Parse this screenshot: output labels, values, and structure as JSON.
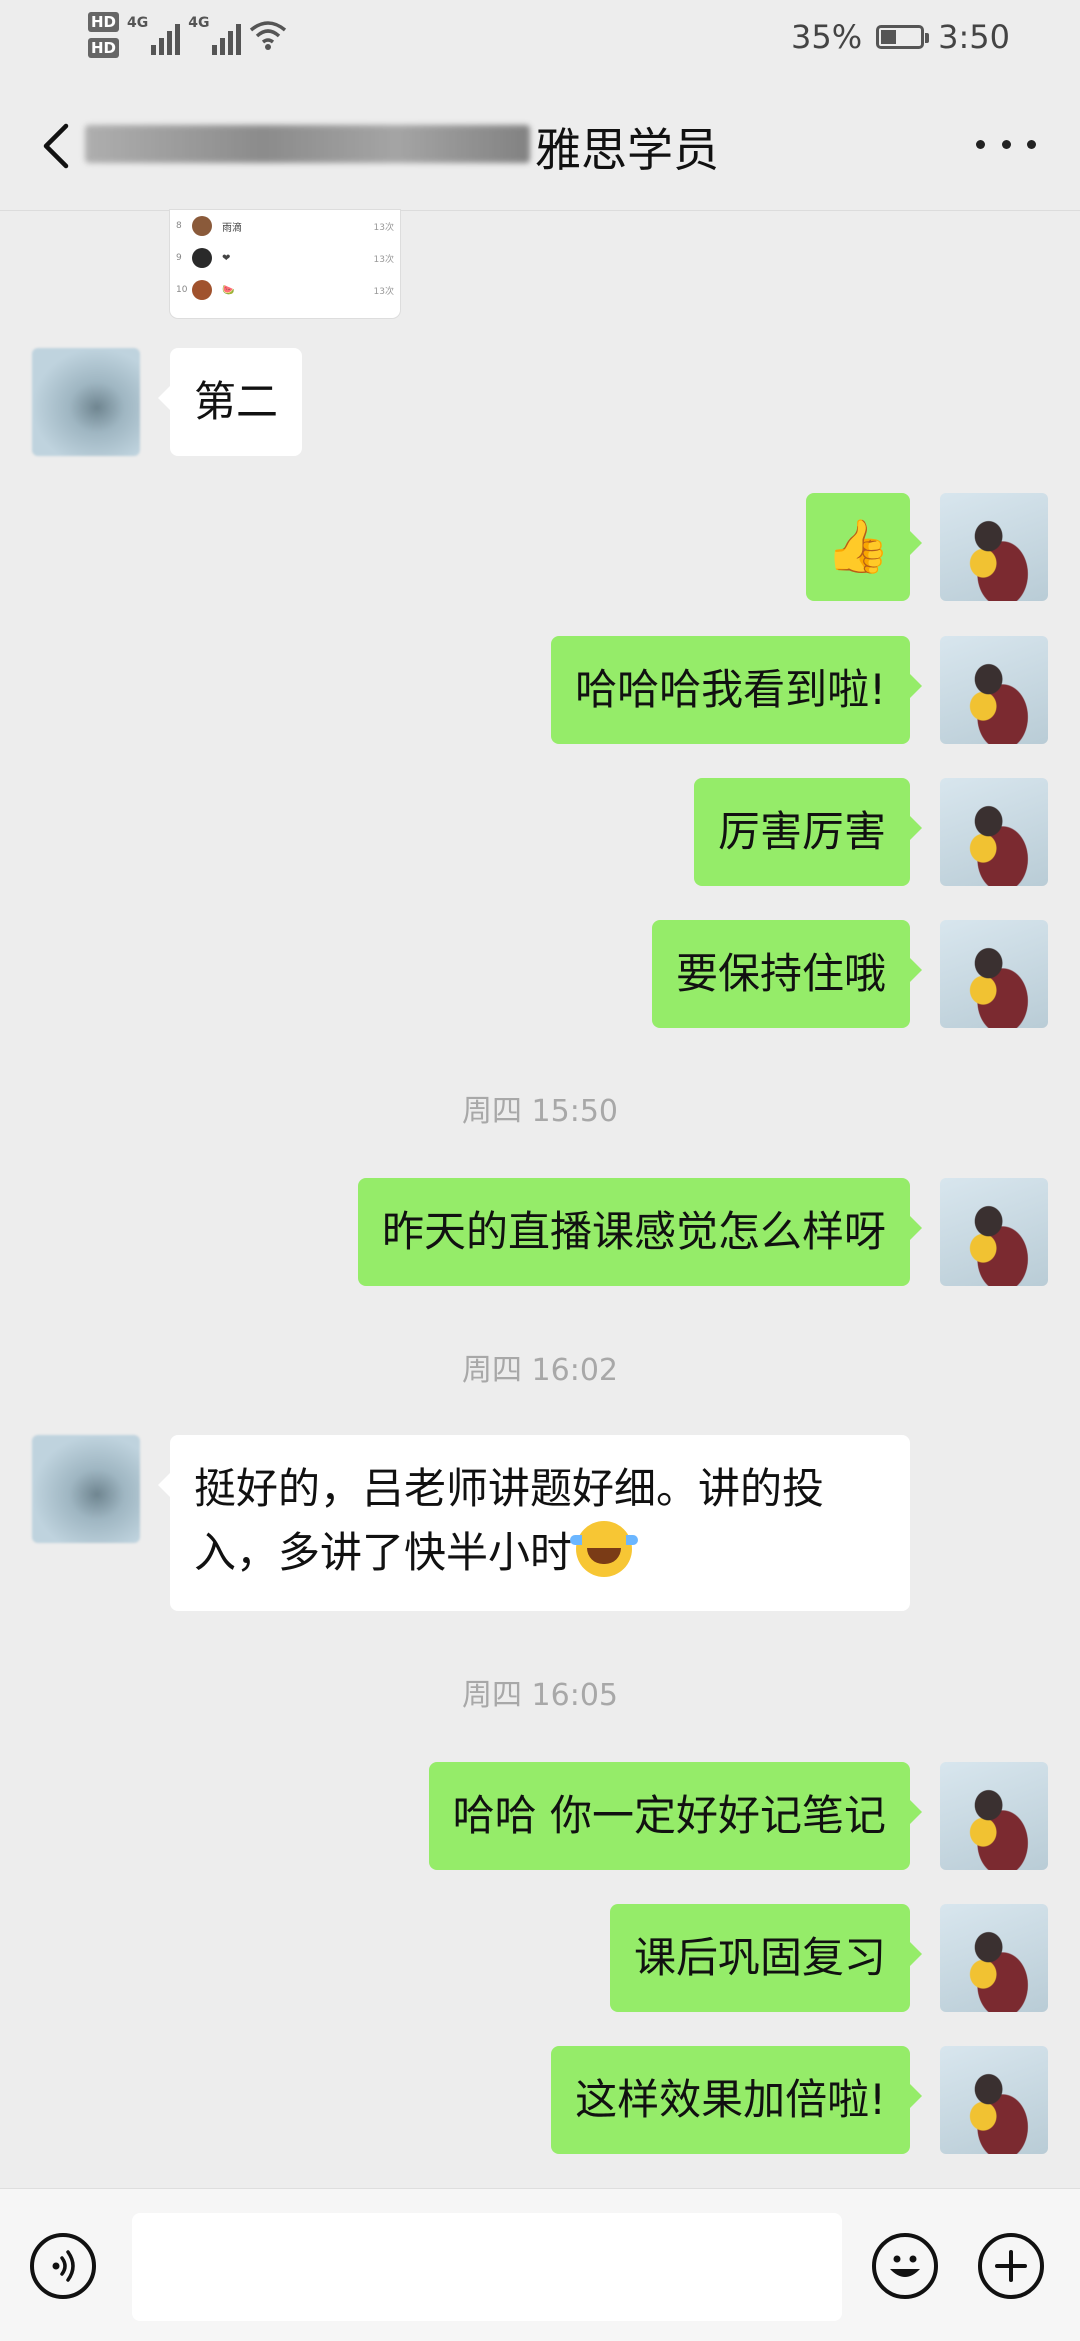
{
  "status_bar": {
    "network1": "4G",
    "network2": "4G",
    "hd1": "HD",
    "hd2": "HD",
    "battery": "35%",
    "battery_level": 0.35,
    "time": "3:50"
  },
  "header": {
    "title": "雅思学员"
  },
  "image_preview": {
    "rows": [
      {
        "num": "8",
        "name": "雨滴",
        "count": "13次"
      },
      {
        "num": "9",
        "name": "❤",
        "count": "13次"
      },
      {
        "num": "10",
        "name": "🍉",
        "count": "13次"
      }
    ]
  },
  "messages": {
    "m1": "第二",
    "m2": "👍",
    "m3": "哈哈哈我看到啦!",
    "m4": "厉害厉害",
    "m5": "要保持住哦",
    "t1": "周四 15:50",
    "m6": "昨天的直播课感觉怎么样呀",
    "t2": "周四 16:02",
    "m7": "挺好的，吕老师讲题好细。讲的投入，多讲了快半小时",
    "t3": "周四 16:05",
    "m8": "哈哈 你一定好好记笔记",
    "m9": "课后巩固复习",
    "m10": "这样效果加倍啦!"
  },
  "icons": {
    "back": "back-arrow-icon",
    "more": "more-icon",
    "voice": "voice-icon",
    "emoji": "emoji-icon",
    "plus": "plus-icon"
  }
}
